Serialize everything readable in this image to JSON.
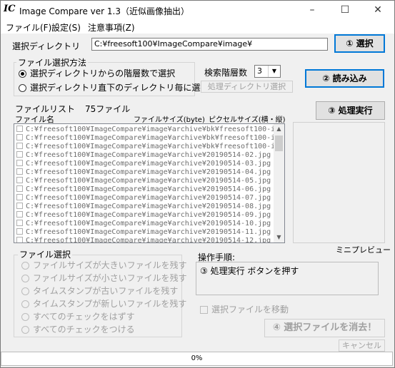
{
  "window": {
    "title": "Image Compare ver 1.3（近似画像抽出）",
    "logo": "IC",
    "min": "–",
    "max": "☐",
    "close": "✕"
  },
  "menu": {
    "file": "ファイル(F)",
    "settings": "設定(S)",
    "notes": "注意事項(Z)"
  },
  "dir": {
    "label": "選択ディレクトリ",
    "value": "C:¥freesoft100¥ImageCompare¥image¥",
    "select_button": "① 選択"
  },
  "file_selection_method": {
    "legend": "ファイル選択方法",
    "options": [
      {
        "label": "選択ディレクトリからの階層数で選択",
        "checked": true
      },
      {
        "label": "選択ディレクトリ直下のディレクトリ毎に選択",
        "checked": false
      }
    ]
  },
  "search_depth": {
    "label": "検索階層数",
    "value": "3"
  },
  "process_dir_button": "処理ディレクトリ選択",
  "load_button": "② 読み込み",
  "execute_button": "③ 処理実行",
  "file_list": {
    "label": "ファイルリスト",
    "count": "75ファイル",
    "col_name": "ファイル名",
    "col_size": "ファイルサイズ(byte)",
    "col_pixel": "ピクセルサイズ(横・縦)",
    "rows": [
      "C:¥freesoft100¥ImageCompare¥image¥archive¥bk¥freesoft100-i",
      "C:¥freesoft100¥ImageCompare¥image¥archive¥bk¥freesoft100-i",
      "C:¥freesoft100¥ImageCompare¥image¥archive¥bk¥freesoft100-i",
      "C:¥freesoft100¥ImageCompare¥image¥archive¥20190514-02.jpg",
      "C:¥freesoft100¥ImageCompare¥image¥archive¥20190514-03.jpg",
      "C:¥freesoft100¥ImageCompare¥image¥archive¥20190514-04.jpg",
      "C:¥freesoft100¥ImageCompare¥image¥archive¥20190514-05.jpg",
      "C:¥freesoft100¥ImageCompare¥image¥archive¥20190514-06.jpg",
      "C:¥freesoft100¥ImageCompare¥image¥archive¥20190514-07.jpg",
      "C:¥freesoft100¥ImageCompare¥image¥archive¥20190514-08.jpg",
      "C:¥freesoft100¥ImageCompare¥image¥archive¥20190514-09.jpg",
      "C:¥freesoft100¥ImageCompare¥image¥archive¥20190514-10.jpg",
      "C:¥freesoft100¥ImageCompare¥image¥archive¥20190514-11.jpg",
      "C:¥freesoft100¥ImageCompare¥image¥archive¥20190514-12.jpg"
    ]
  },
  "mini_preview_label": "ミニプレビュー",
  "file_select_group": {
    "legend": "ファイル選択",
    "options": [
      "ファイルサイズが大きいファイルを残す",
      "ファイルサイズが小さいファイルを残す",
      "タイムスタンプが古いファイルを残す",
      "タイムスタンプが新しいファイルを残す",
      "すべてのチェックをはずす",
      "すべてのチェックをつける"
    ]
  },
  "procedure": {
    "label": "操作手順:",
    "text": "③ 処理実行 ボタンを押す"
  },
  "move_checkbox": "選択ファイルを移動",
  "delete_button": "④ 選択ファイルを消去！",
  "cancel_button": "キャンセル",
  "progress": {
    "value_text": "0%",
    "percent": 0
  }
}
